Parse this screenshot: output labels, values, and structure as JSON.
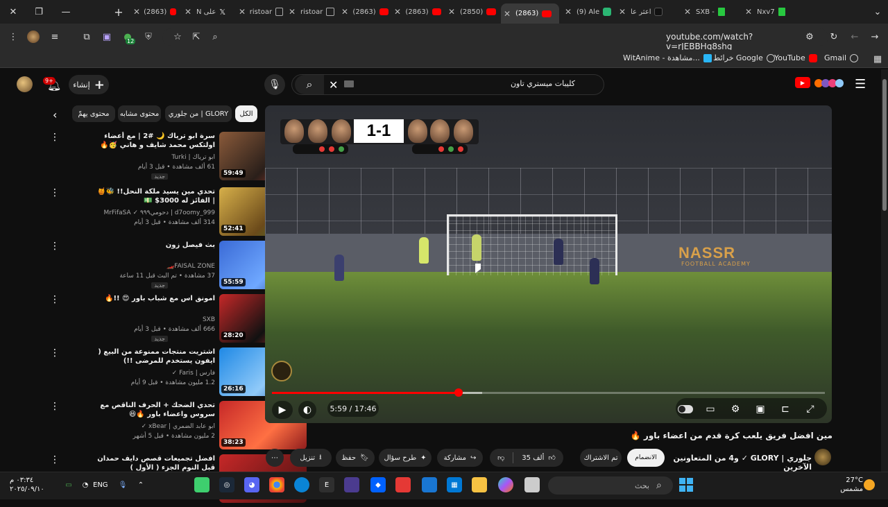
{
  "browser": {
    "tabs": [
      {
        "label": "(2863)",
        "favicon": "youtube"
      },
      {
        "label": "N على",
        "favicon": "x"
      },
      {
        "label": "ristoar",
        "favicon": "readme"
      },
      {
        "label": "ristoar",
        "favicon": "readme"
      },
      {
        "label": "(2863)",
        "favicon": "youtube"
      },
      {
        "label": "(2863)",
        "favicon": "youtube"
      },
      {
        "label": "(2850)",
        "favicon": "youtube"
      },
      {
        "label": "(2863)",
        "favicon": "youtube",
        "active": true
      },
      {
        "label": "(9) Ale",
        "favicon": "green"
      },
      {
        "label": "اعثر عا",
        "favicon": "tiktok"
      },
      {
        "label": "SXB -",
        "favicon": "kick"
      },
      {
        "label": "Nxv7",
        "favicon": "kick"
      }
    ],
    "url": "youtube.com/watch?v=rJEBBHq8shg",
    "extension_badge": "12",
    "bookmarks": [
      {
        "label": "Gmail",
        "icon": "gmail"
      },
      {
        "label": "YouTube",
        "icon": "youtube"
      },
      {
        "label": "خرائط Google",
        "icon": "maps"
      },
      {
        "label": "WitAnime - مشاهدة...",
        "icon": "witanime"
      }
    ]
  },
  "youtube": {
    "search_query": "كليبات ميستري تاون",
    "create_label": "إنشاء",
    "notifications_count": "9+",
    "chips": [
      "الكل",
      "من جلوري | GLORY",
      "محتوى مشابه",
      "محتوى يهمّ"
    ],
    "recommendations": [
      {
        "title": "سرة ابو ترياك 🌙 #2 | مع أعضاء اولتكس محمد شايف و هاني 🥳🔥 !!",
        "channel": "ابو ترياك | Turki",
        "meta": "61 ألف مشاهدة • قبل 3 أيام",
        "badge": "جديد",
        "duration": "59:49"
      },
      {
        "title": "تحدي مين يسيد ملكة النحل!! 🐝🍯 | الفائز له 3000$ 💵",
        "channel": "d7oomy_999 | دحومي٩٩٩ ✓ MrFifaSA",
        "meta": "314 ألف مشاهدة • قبل 3 أيام",
        "badge": "",
        "duration": "52:41"
      },
      {
        "title": "بث فيصل زون",
        "channel": "FAISAL ZONE🏎️",
        "meta": "37 مشاهدة • تم البث قبل 11 ساعة",
        "badge": "جديد",
        "duration": "55:59"
      },
      {
        "title": "امونق اس مع شباب باور 😍 !!🔥",
        "channel": "SXB",
        "meta": "666 ألف مشاهدة • قبل 3 أيام",
        "badge": "جديد",
        "duration": "28:20"
      },
      {
        "title": "اشتريت منتجات ممنوعة من البيع ( ايفون يستخدم للمرضى !!)",
        "channel": "فارس | Faris ✓",
        "meta": "1.2 مليون مشاهدة • قبل 9 أيام",
        "badge": "",
        "duration": "26:16"
      },
      {
        "title": "تحدي الضحك + الحرف الناقص مع سروس واعضاء باور 🔥😆",
        "channel": "ابو عابد الضمري | xBear ✓",
        "meta": "2 مليون مشاهدة • قبل 5 أشهر",
        "badge": "",
        "duration": "38:23"
      },
      {
        "title": "افضل تجميعات قصص دايف حمدان قبل النوم الجزء ( الأول )",
        "channel": "",
        "meta": "",
        "badge": "",
        "duration": ""
      }
    ],
    "player": {
      "score": "1-1",
      "overlay_text_nassr": "NASSR",
      "overlay_text_academy": "FOOTBALL ACADEMY",
      "time_current": "5:59",
      "time_total": "17:46",
      "time_display": "5:59 / 17:46",
      "progress": 0.337,
      "buffered": 0.38
    },
    "video_title": "مين افضل فريق يلعب كرة قدم من اعضاء باور 🔥",
    "channel_line": "جلوري | GLORY ✓ و4 من المتعاونين الآخرين",
    "join_label": "الانضمام",
    "subscribed_label": "تم الاشتراك",
    "likes_label": "35 ألف",
    "share_label": "مشاركة",
    "ask_label": "طرح سؤال",
    "save_label": "حفظ",
    "download_label": "تنزيل"
  },
  "taskbar": {
    "search_placeholder": "بحث",
    "language": "ENG",
    "time": "٠٣:٣٤ م",
    "date": "٢٠٢٥/٠٩/١٠",
    "temperature": "27°C",
    "weather_desc": "مشمس"
  }
}
